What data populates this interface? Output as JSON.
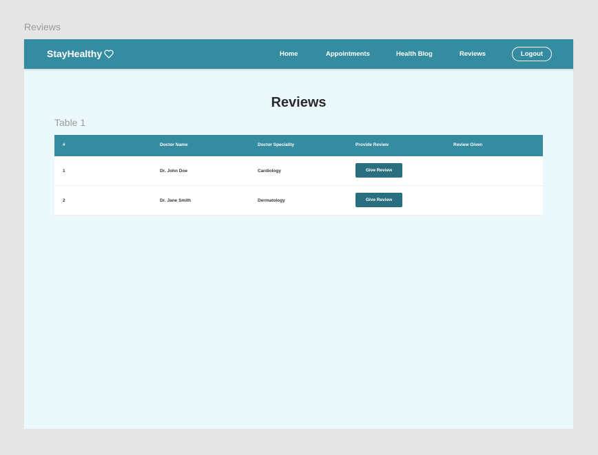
{
  "frame": {
    "label": "Reviews"
  },
  "navbar": {
    "brand": "StayHealthy",
    "brand_icon": "heart-outline-icon",
    "links": [
      "Home",
      "Appointments",
      "Health Blog",
      "Reviews"
    ],
    "logout_label": "Logout",
    "color": "#358ba0"
  },
  "main": {
    "title": "Reviews",
    "table_caption": "Table 1",
    "table": {
      "headers": [
        "#",
        "Doctor Name",
        "Doctor Speciality",
        "Provide Review",
        "Review Given"
      ],
      "rows": [
        {
          "index": "1",
          "doctor_name": "Dr. John Doe",
          "speciality": "Cardiology",
          "button_label": "Give Review",
          "review_given": ""
        },
        {
          "index": "2",
          "doctor_name": "Dr. Jane Smith",
          "speciality": "Dermatology",
          "button_label": "Give Review",
          "review_given": ""
        }
      ]
    }
  },
  "colors": {
    "background": "#e5e5e5",
    "frame_bg": "#ebf8fc",
    "accent": "#358ba0",
    "button": "#2a6f80"
  }
}
